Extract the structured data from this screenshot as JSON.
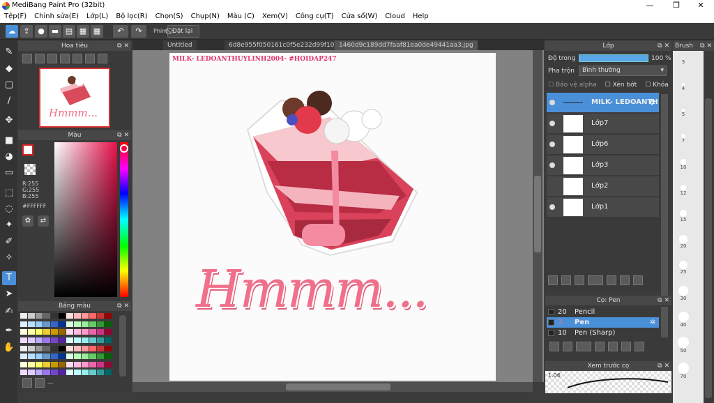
{
  "window": {
    "title": "MediBang Paint Pro (32bit)",
    "min": "—",
    "max": "❐",
    "close": "✕"
  },
  "menu": [
    "Tệp(F)",
    "Chỉnh sửa(E)",
    "Lớp(L)",
    "Bộ lọc(R)",
    "Chọn(S)",
    "Chụp(N)",
    "Màu (C)",
    "Xem(V)",
    "Công cụ(T)",
    "Cửa sổ(W)",
    "Cloud",
    "Help"
  ],
  "toolbar": {
    "phim_label": "Phím",
    "reset_label": "Đặt lại"
  },
  "tabs": [
    "Untitled",
    "6d8e955f050161c0f5e232d99f10c756.jpg",
    "1460d9c189dd7faaf81ea0de49441aa3.jpg"
  ],
  "navigator": {
    "title": "Hoa tiêu"
  },
  "color": {
    "title": "Màu",
    "r": "R:255",
    "g": "G:255",
    "b": "B:255",
    "hex": "#FFFFFF"
  },
  "palette": {
    "title": "Bảng màu",
    "footer": "---"
  },
  "canvas": {
    "watermark": "MILK- LEDOANTHUYLINH2004- #HOIDAP247",
    "lettering": "Hmmm..."
  },
  "layers": {
    "title": "Lớp",
    "opacity_label": "Độ trong",
    "opacity_value": "100 %",
    "blend_label": "Pha trộn",
    "blend_value": "Bình thường",
    "protect_alpha": "Bảo vệ alpha",
    "clip": "Xén bớt",
    "lock": "Khóa",
    "items": [
      {
        "name": "MILK- LEDOANTH"
      },
      {
        "name": "Lớp7"
      },
      {
        "name": "Lớp6"
      },
      {
        "name": "Lớp3"
      },
      {
        "name": "Lớp2"
      },
      {
        "name": "Lớp1"
      }
    ]
  },
  "brushes": {
    "title": "Cọ: Pen",
    "items": [
      {
        "size": "20",
        "name": "Pencil"
      },
      {
        "size": "3",
        "name": "Pen"
      },
      {
        "size": "10",
        "name": "Pen (Sharp)"
      }
    ]
  },
  "preview": {
    "title": "Xem trước cọ",
    "value": "1.06"
  },
  "brushsize": {
    "title": "Brush",
    "sizes": [
      "3",
      "4",
      "5",
      "7",
      "10",
      "12",
      "15",
      "20",
      "25",
      "30",
      "40",
      "50",
      "70"
    ]
  },
  "colors": {
    "accent": "#4a90d9",
    "pink": "#f06f8a"
  }
}
